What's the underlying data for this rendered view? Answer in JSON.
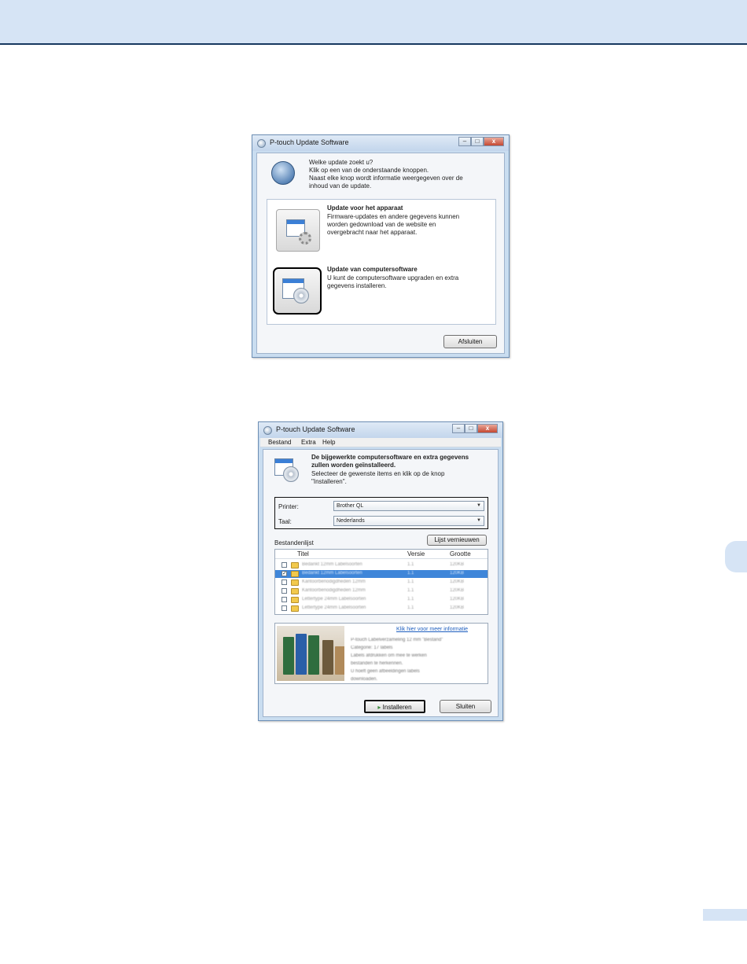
{
  "dialog1": {
    "title": "P-touch Update Software",
    "question": "Welke update zoekt u?",
    "instruction": "Klik op een van de onderstaande knoppen.",
    "info_line1": "Naast elke knop wordt informatie weergegeven over de",
    "info_line2": "inhoud van de update.",
    "option1": {
      "title": "Update voor het apparaat",
      "line1": "Firmware-updates en andere gegevens kunnen",
      "line2": "worden gedownload van de website en",
      "line3": "overgebracht naar het apparaat."
    },
    "option2": {
      "title": "Update van computersoftware",
      "line1": "U kunt de computersoftware upgraden en extra",
      "line2": "gegevens installeren."
    },
    "close_button": "Afsluiten"
  },
  "dialog2": {
    "title": "P-touch Update Software",
    "menu": [
      "Bestand",
      "Extra",
      "Help"
    ],
    "header_line1": "De bijgewerkte computersoftware en extra gegevens",
    "header_line2": "zullen worden geïnstalleerd.",
    "header_line3": "Selecteer de gewenste items en klik op de knop",
    "header_line4": "\"Installeren\".",
    "printer_label": "Printer:",
    "printer_value": "Brother QL",
    "language_label": "Taal:",
    "language_value": "Nederlands",
    "filelist_label": "Bestandenlijst",
    "refresh_button": "Lijst vernieuwen",
    "columns": [
      "Titel",
      "Versie",
      "Grootte"
    ],
    "rows": [
      {
        "title": "Bedankt 12mm Labelsoorten",
        "version": "1.1",
        "size": "120KB",
        "checked": false,
        "selected": false
      },
      {
        "title": "Bedankt 12mm Labelsoorten",
        "version": "1.1",
        "size": "120KB",
        "checked": true,
        "selected": true
      },
      {
        "title": "Kantoorbenodigdheden 12mm",
        "version": "1.1",
        "size": "120KB",
        "checked": false,
        "selected": false
      },
      {
        "title": "Kantoorbenodigdheden 12mm",
        "version": "1.1",
        "size": "120KB",
        "checked": false,
        "selected": false
      },
      {
        "title": "Lettertype 24mm Labelsoorten",
        "version": "1.1",
        "size": "120KB",
        "checked": false,
        "selected": false
      },
      {
        "title": "Lettertype 24mm Labelsoorten",
        "version": "1.1",
        "size": "120KB",
        "checked": false,
        "selected": false
      }
    ],
    "info_link": "Klik hier voor meer informatie",
    "info_lines": [
      "P-touch Labelverzameling 12 mm \"Bestand\"",
      "Categorie: 17 labels",
      "Labels afdrukken om mee te werken",
      "bestanden te herkennen.",
      "U hoeft geen afbeeldingen labels",
      "downloaden."
    ],
    "install_button": "Installeren",
    "close_button": "Sluiten"
  }
}
